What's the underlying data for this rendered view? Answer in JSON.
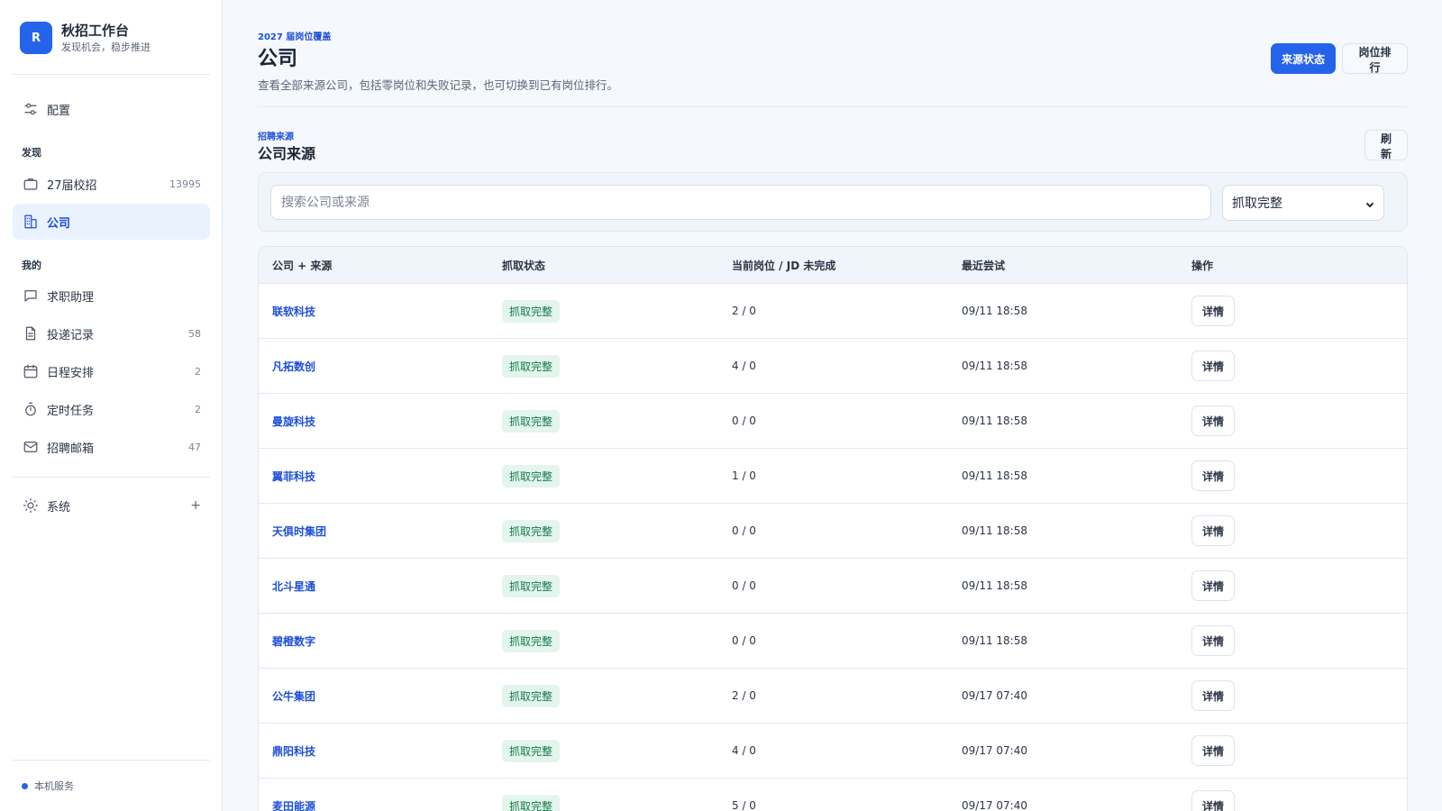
{
  "sidebar": {
    "brand": {
      "logo_letter": "R",
      "title": "秋招工作台",
      "subtitle": "发现机会，稳步推进"
    },
    "config": {
      "label": "配置",
      "icon": "sliders-icon"
    },
    "sections": {
      "discover": "发现",
      "mine": "我的"
    },
    "items": [
      {
        "label": "27届校招",
        "count": "13995",
        "icon": "briefcase-icon"
      },
      {
        "label": "公司",
        "count": "",
        "icon": "building-icon",
        "active": true
      },
      {
        "label": "求职助理",
        "count": "",
        "icon": "chat-icon"
      },
      {
        "label": "投递记录",
        "count": "58",
        "icon": "document-icon"
      },
      {
        "label": "日程安排",
        "count": "2",
        "icon": "calendar-icon"
      },
      {
        "label": "定时任务",
        "count": "2",
        "icon": "timer-icon"
      },
      {
        "label": "招聘邮箱",
        "count": "47",
        "icon": "mail-icon"
      }
    ],
    "system": {
      "label": "系统",
      "plus": "+",
      "icon": "sun-icon"
    },
    "service": {
      "label": "本机服务"
    }
  },
  "header": {
    "eyebrow": "2027 届岗位覆盖",
    "title": "公司",
    "description": "查看全部来源公司，包括零岗位和失败记录，也可切换到已有岗位排行。",
    "tab_source": "来源状态",
    "tab_ranking": "岗位排行"
  },
  "section": {
    "eyebrow": "招聘来源",
    "title": "公司来源",
    "refresh": "刷新"
  },
  "filters": {
    "search_placeholder": "搜索公司或来源",
    "status_selected": "抓取完整"
  },
  "table": {
    "headers": [
      "公司 + 来源",
      "抓取状态",
      "当前岗位 / JD 未完成",
      "最近尝试",
      "操作"
    ],
    "rows": [
      {
        "company": "联软科技",
        "status": "抓取完整",
        "jobs": "2 / 0",
        "time": "09/11 18:58",
        "action": "详情"
      },
      {
        "company": "凡拓数创",
        "status": "抓取完整",
        "jobs": "4 / 0",
        "time": "09/11 18:58",
        "action": "详情"
      },
      {
        "company": "曼旋科技",
        "status": "抓取完整",
        "jobs": "0 / 0",
        "time": "09/11 18:58",
        "action": "详情"
      },
      {
        "company": "翼菲科技",
        "status": "抓取完整",
        "jobs": "1 / 0",
        "time": "09/11 18:58",
        "action": "详情"
      },
      {
        "company": "天俱时集团",
        "status": "抓取完整",
        "jobs": "0 / 0",
        "time": "09/11 18:58",
        "action": "详情"
      },
      {
        "company": "北斗星通",
        "status": "抓取完整",
        "jobs": "0 / 0",
        "time": "09/11 18:58",
        "action": "详情"
      },
      {
        "company": "碧橙数字",
        "status": "抓取完整",
        "jobs": "0 / 0",
        "time": "09/11 18:58",
        "action": "详情"
      },
      {
        "company": "公牛集团",
        "status": "抓取完整",
        "jobs": "2 / 0",
        "time": "09/17 07:40",
        "action": "详情"
      },
      {
        "company": "鼎阳科技",
        "status": "抓取完整",
        "jobs": "4 / 0",
        "time": "09/17 07:40",
        "action": "详情"
      },
      {
        "company": "麦田能源",
        "status": "抓取完整",
        "jobs": "5 / 0",
        "time": "09/17 07:40",
        "action": "详情"
      }
    ]
  }
}
